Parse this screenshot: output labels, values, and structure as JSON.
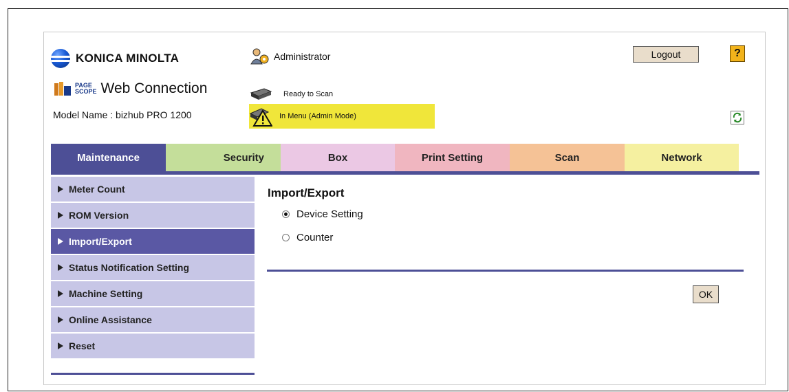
{
  "header": {
    "brand": "KONICA MINOLTA",
    "product_small_top": "PAGE",
    "product_small_bottom": "SCOPE",
    "product": "Web Connection",
    "model_label": "Model Name : bizhub PRO 1200",
    "user": "Administrator",
    "status_ready": "Ready to Scan",
    "status_mode": "In Menu (Admin Mode)",
    "logout_label": "Logout",
    "help_label": "?"
  },
  "tabs": [
    {
      "label": "Maintenance",
      "color": "#4d4f96",
      "text_color": "#ffffff"
    },
    {
      "label": "Security",
      "color": "#c4de9a",
      "text_color": "#222222"
    },
    {
      "label": "Box",
      "color": "#ebc8e4",
      "text_color": "#222222"
    },
    {
      "label": "Print Setting",
      "color": "#f0b6c0",
      "text_color": "#222222"
    },
    {
      "label": "Scan",
      "color": "#f5c296",
      "text_color": "#222222"
    },
    {
      "label": "Network",
      "color": "#f5f0a0",
      "text_color": "#222222"
    }
  ],
  "sidebar": {
    "items": [
      {
        "label": "Meter Count",
        "active": false
      },
      {
        "label": "ROM Version",
        "active": false
      },
      {
        "label": "Import/Export",
        "active": true
      },
      {
        "label": "Status Notification Setting",
        "active": false
      },
      {
        "label": "Machine Setting",
        "active": false
      },
      {
        "label": "Online Assistance",
        "active": false
      },
      {
        "label": "Reset",
        "active": false
      }
    ]
  },
  "main": {
    "title": "Import/Export",
    "options": [
      {
        "label": "Device Setting",
        "checked": true
      },
      {
        "label": "Counter",
        "checked": false
      }
    ],
    "ok_label": "OK"
  },
  "colors": {
    "accent": "#4d4f96",
    "sidebar_bg": "#c7c6e6",
    "sidebar_active": "#5a58a4",
    "status_highlight": "#f0e63a"
  }
}
